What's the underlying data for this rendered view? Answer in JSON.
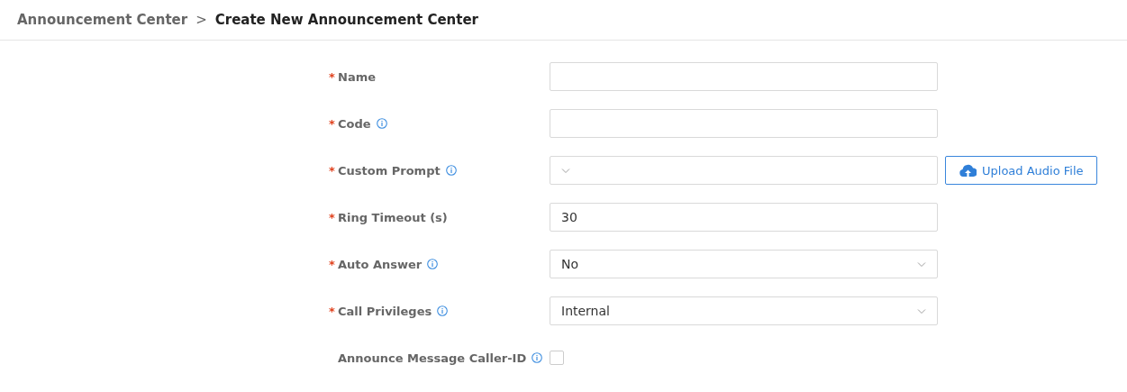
{
  "breadcrumb": {
    "parent": "Announcement Center",
    "separator": ">",
    "current": "Create New Announcement Center"
  },
  "fields": [
    {
      "kind": "text",
      "required_mark": "*",
      "label": "Name",
      "info": false
    },
    {
      "kind": "text",
      "required_mark": "*",
      "label": "Code",
      "info": true
    },
    {
      "kind": "select",
      "required_mark": "*",
      "label": "Custom Prompt",
      "info": true,
      "button": "Upload Audio File"
    },
    {
      "kind": "text",
      "required_mark": "*",
      "label": "Ring Timeout (s)",
      "info": false,
      "value": "30"
    },
    {
      "kind": "select",
      "required_mark": "*",
      "label": "Auto Answer",
      "info": true,
      "value": "No"
    },
    {
      "kind": "select",
      "required_mark": "*",
      "label": "Call Privileges",
      "info": true,
      "value": "Internal"
    },
    {
      "kind": "checkbox",
      "label": "Announce Message Caller-ID",
      "info": true,
      "checked": false
    }
  ]
}
